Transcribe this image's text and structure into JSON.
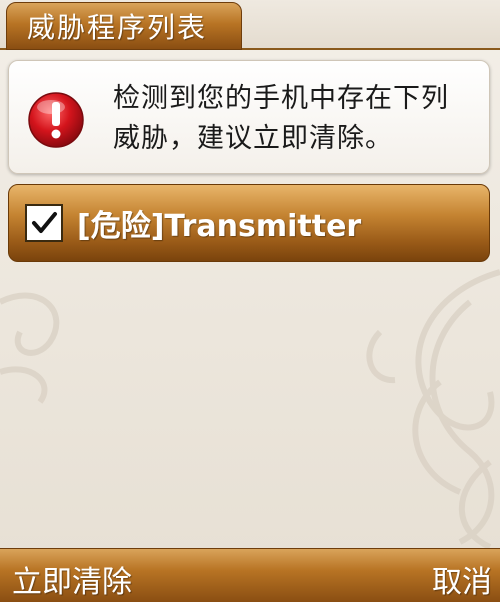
{
  "tab": {
    "title": "威胁程序列表"
  },
  "message": {
    "icon": "warning-exclamation-icon",
    "text": "检测到您的手机中存在下列威胁，建议立即清除。"
  },
  "threats": [
    {
      "label": "[危险]Transmitter",
      "checked": true
    }
  ],
  "softkeys": {
    "left": "立即清除",
    "right": "取消"
  },
  "colors": {
    "accent_brown": "#b87424",
    "warning_red": "#d4141c",
    "background": "#ece6dc"
  }
}
